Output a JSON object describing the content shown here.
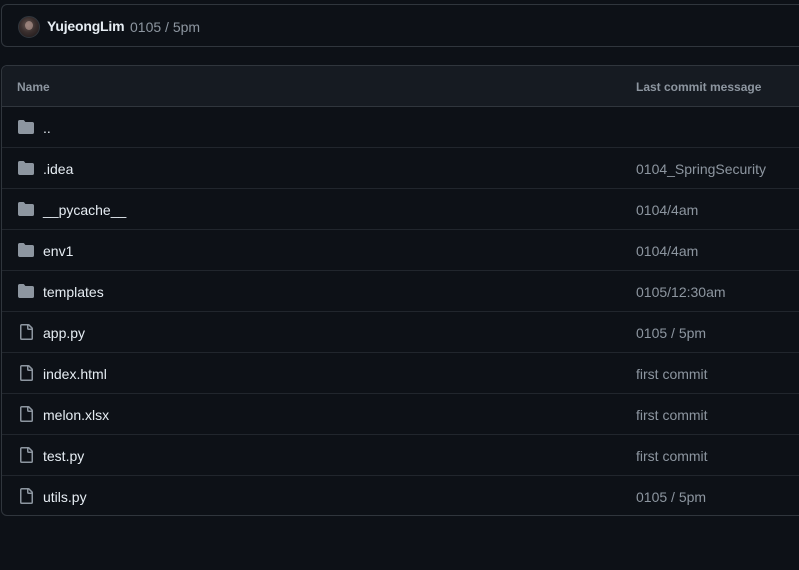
{
  "commit": {
    "author": "YujeongLim",
    "message": "0105 / 5pm"
  },
  "table": {
    "headers": {
      "name": "Name",
      "last_commit": "Last commit message"
    },
    "rows": [
      {
        "type": "folder",
        "icon": "folder-icon",
        "name": "..",
        "message": ""
      },
      {
        "type": "folder",
        "icon": "folder-icon",
        "name": ".idea",
        "message": "0104_SpringSecurity"
      },
      {
        "type": "folder",
        "icon": "folder-icon",
        "name": "__pycache__",
        "message": "0104/4am"
      },
      {
        "type": "folder",
        "icon": "folder-icon",
        "name": "env1",
        "message": "0104/4am"
      },
      {
        "type": "folder",
        "icon": "folder-icon",
        "name": "templates",
        "message": "0105/12:30am"
      },
      {
        "type": "file",
        "icon": "file-icon",
        "name": "app.py",
        "message": "0105 / 5pm"
      },
      {
        "type": "file",
        "icon": "file-icon",
        "name": "index.html",
        "message": "first commit"
      },
      {
        "type": "file",
        "icon": "file-icon",
        "name": "melon.xlsx",
        "message": "first commit"
      },
      {
        "type": "file",
        "icon": "file-icon",
        "name": "test.py",
        "message": "first commit"
      },
      {
        "type": "file",
        "icon": "file-icon",
        "name": "utils.py",
        "message": "0105 / 5pm"
      }
    ]
  },
  "colors": {
    "background": "#0d1117",
    "header_bg": "#161b22",
    "border": "#30363d",
    "text_primary": "#e6edf3",
    "text_muted": "#8d96a0",
    "icon": "#8d96a0"
  }
}
